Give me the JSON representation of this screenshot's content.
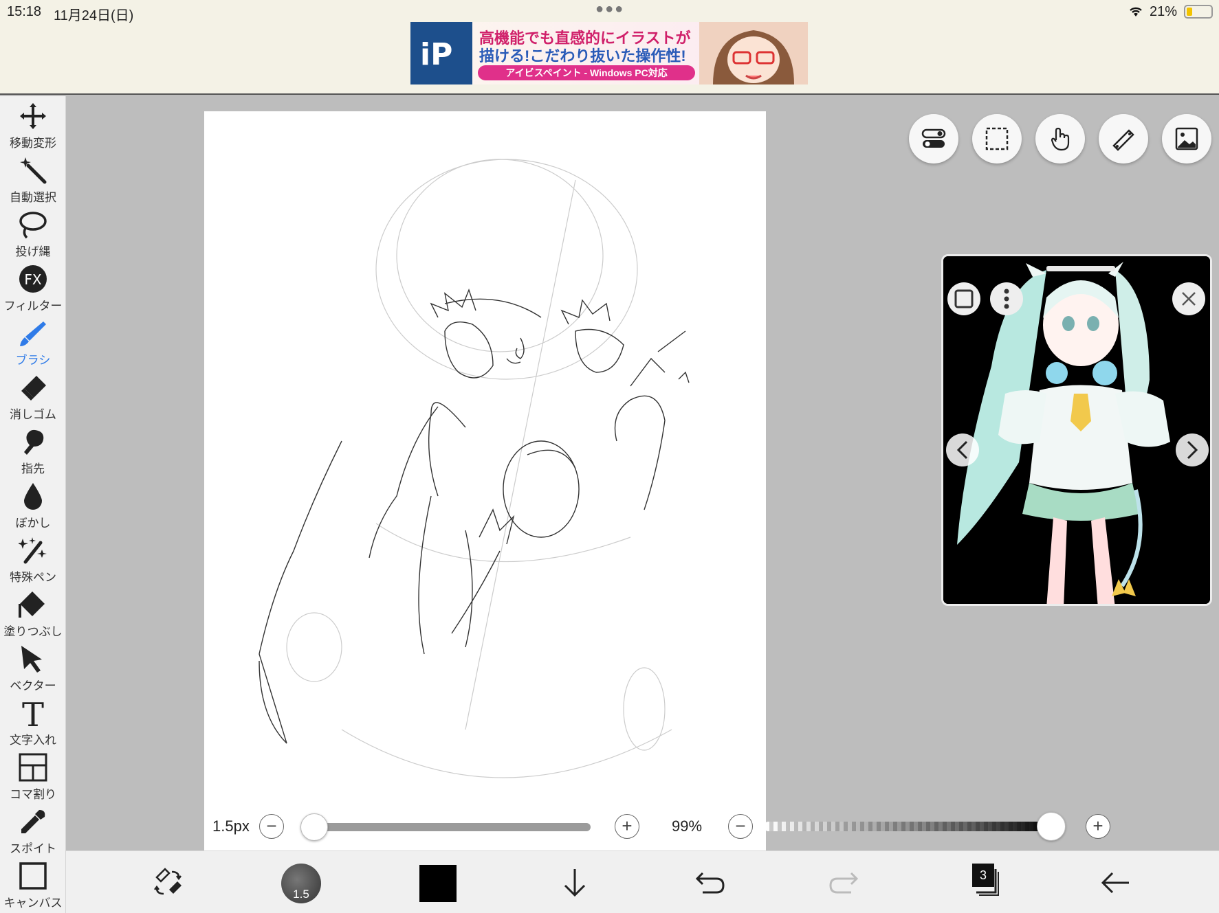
{
  "status_bar": {
    "time": "15:18",
    "date": "11月24日(日)",
    "battery": "21%",
    "icons": [
      "multitask-dots-icon",
      "wifi-icon",
      "battery-icon"
    ]
  },
  "ad": {
    "logo": "iP",
    "line1": "高機能でも直感的にイラストが",
    "line2": "描ける!こだわり抜いた操作性!",
    "badge": "アイビスペイント - Windows PC対応"
  },
  "tools": [
    {
      "label": "移動変形",
      "icon": "move-icon"
    },
    {
      "label": "自動選択",
      "icon": "magic-wand-icon"
    },
    {
      "label": "投げ縄",
      "icon": "lasso-icon"
    },
    {
      "label": "フィルター",
      "icon": "fx-icon"
    },
    {
      "label": "ブラシ",
      "icon": "brush-icon"
    },
    {
      "label": "消しゴム",
      "icon": "eraser-icon"
    },
    {
      "label": "指先",
      "icon": "finger-icon"
    },
    {
      "label": "ぼかし",
      "icon": "blur-drop-icon"
    },
    {
      "label": "特殊ペン",
      "icon": "special-pen-icon"
    },
    {
      "label": "塗りつぶし",
      "icon": "fill-icon"
    },
    {
      "label": "ベクター",
      "icon": "vector-arrow-icon"
    },
    {
      "label": "文字入れ",
      "icon": "text-icon"
    },
    {
      "label": "コマ割り",
      "icon": "frame-divider-icon"
    },
    {
      "label": "スポイト",
      "icon": "eyedropper-icon"
    },
    {
      "label": "キャンバス",
      "icon": "canvas-icon"
    }
  ],
  "active_tool": "ブラシ",
  "sliders": {
    "brush_size": "1.5px",
    "brush_size_fraction": 0.0,
    "opacity": "99%",
    "opacity_fraction": 0.99,
    "minus": "−",
    "plus": "+"
  },
  "bottom": {
    "brush_preview_size": "1.5",
    "color": "#000000",
    "layer_count": "3"
  },
  "colors": {
    "accent": "#2f7be8",
    "canvas": "#ffffff",
    "workspace": "#bdbdbd"
  }
}
